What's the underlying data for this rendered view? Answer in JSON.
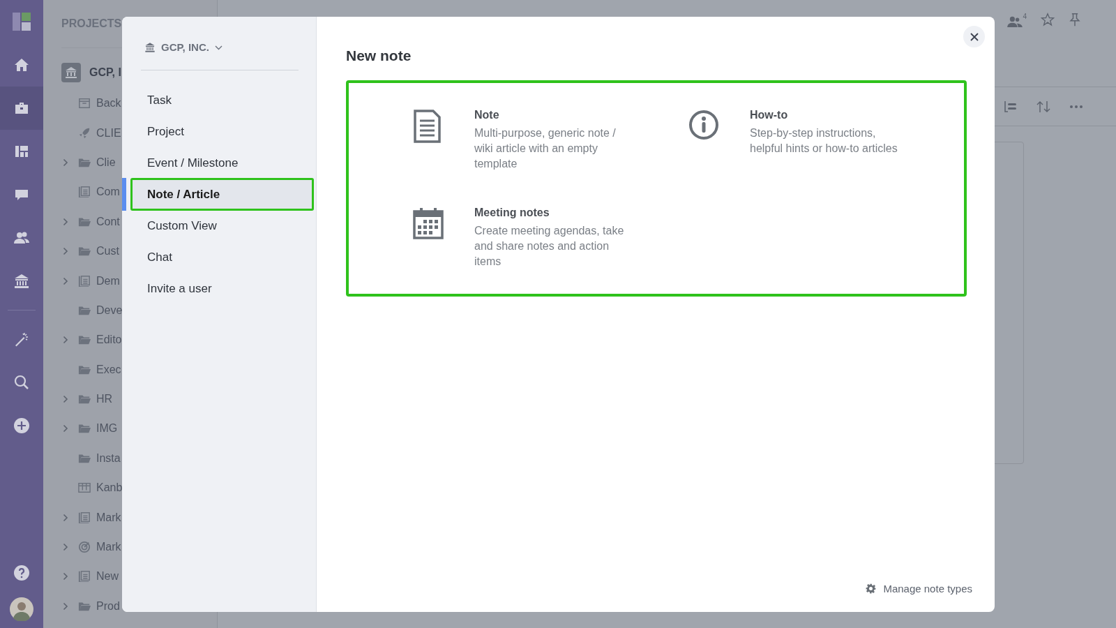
{
  "rail": {
    "items": [
      {
        "selected": false
      },
      {
        "selected": true
      },
      {
        "selected": false
      },
      {
        "selected": false
      },
      {
        "selected": false
      },
      {
        "selected": false
      },
      {
        "selected": false
      },
      {
        "selected": false
      },
      {
        "selected": false
      }
    ]
  },
  "projects": {
    "header": "PROJECTS",
    "root": "GCP, I",
    "items": [
      {
        "label": "Back",
        "kind": "archive",
        "expandable": false
      },
      {
        "label": "CLIE",
        "kind": "rocket",
        "expandable": false
      },
      {
        "label": "Clie",
        "kind": "folder",
        "expandable": true
      },
      {
        "label": "Com",
        "kind": "stack",
        "expandable": false
      },
      {
        "label": "Cont",
        "kind": "folder",
        "expandable": true
      },
      {
        "label": "Cust",
        "kind": "folder",
        "expandable": true
      },
      {
        "label": "Dem",
        "kind": "stack",
        "expandable": true
      },
      {
        "label": "Deve",
        "kind": "folder",
        "expandable": false
      },
      {
        "label": "Edito",
        "kind": "folder",
        "expandable": true
      },
      {
        "label": "Exec",
        "kind": "folder",
        "expandable": false
      },
      {
        "label": "HR",
        "kind": "folder",
        "expandable": true
      },
      {
        "label": "IMG",
        "kind": "folder",
        "expandable": true
      },
      {
        "label": "Insta",
        "kind": "folder",
        "expandable": false
      },
      {
        "label": "Kanb",
        "kind": "kanban",
        "expandable": false
      },
      {
        "label": "Mark",
        "kind": "stack",
        "expandable": true
      },
      {
        "label": "Mark",
        "kind": "target",
        "expandable": true
      },
      {
        "label": "New",
        "kind": "stack",
        "expandable": true
      },
      {
        "label": "Prod",
        "kind": "folder",
        "expandable": true
      }
    ]
  },
  "topbar": {
    "members_count": "4"
  },
  "modal": {
    "org": "GCP, INC.",
    "menu": [
      {
        "label": "Task",
        "selected": false
      },
      {
        "label": "Project",
        "selected": false
      },
      {
        "label": "Event / Milestone",
        "selected": false
      },
      {
        "label": "Note / Article",
        "selected": true
      },
      {
        "label": "Custom View",
        "selected": false
      },
      {
        "label": "Chat",
        "selected": false
      },
      {
        "label": "Invite a user",
        "selected": false
      }
    ],
    "title": "New note",
    "note_types": [
      {
        "kind": "document",
        "title": "Note",
        "description": "Multi-purpose, generic note / wiki article with an empty template"
      },
      {
        "kind": "info",
        "title": "How-to",
        "description": "Step-by-step instructions, helpful hints or how-to articles"
      },
      {
        "kind": "calendar",
        "title": "Meeting notes",
        "description": "Create meeting agendas, take and share notes and action items"
      }
    ],
    "manage_link": "Manage note types"
  }
}
